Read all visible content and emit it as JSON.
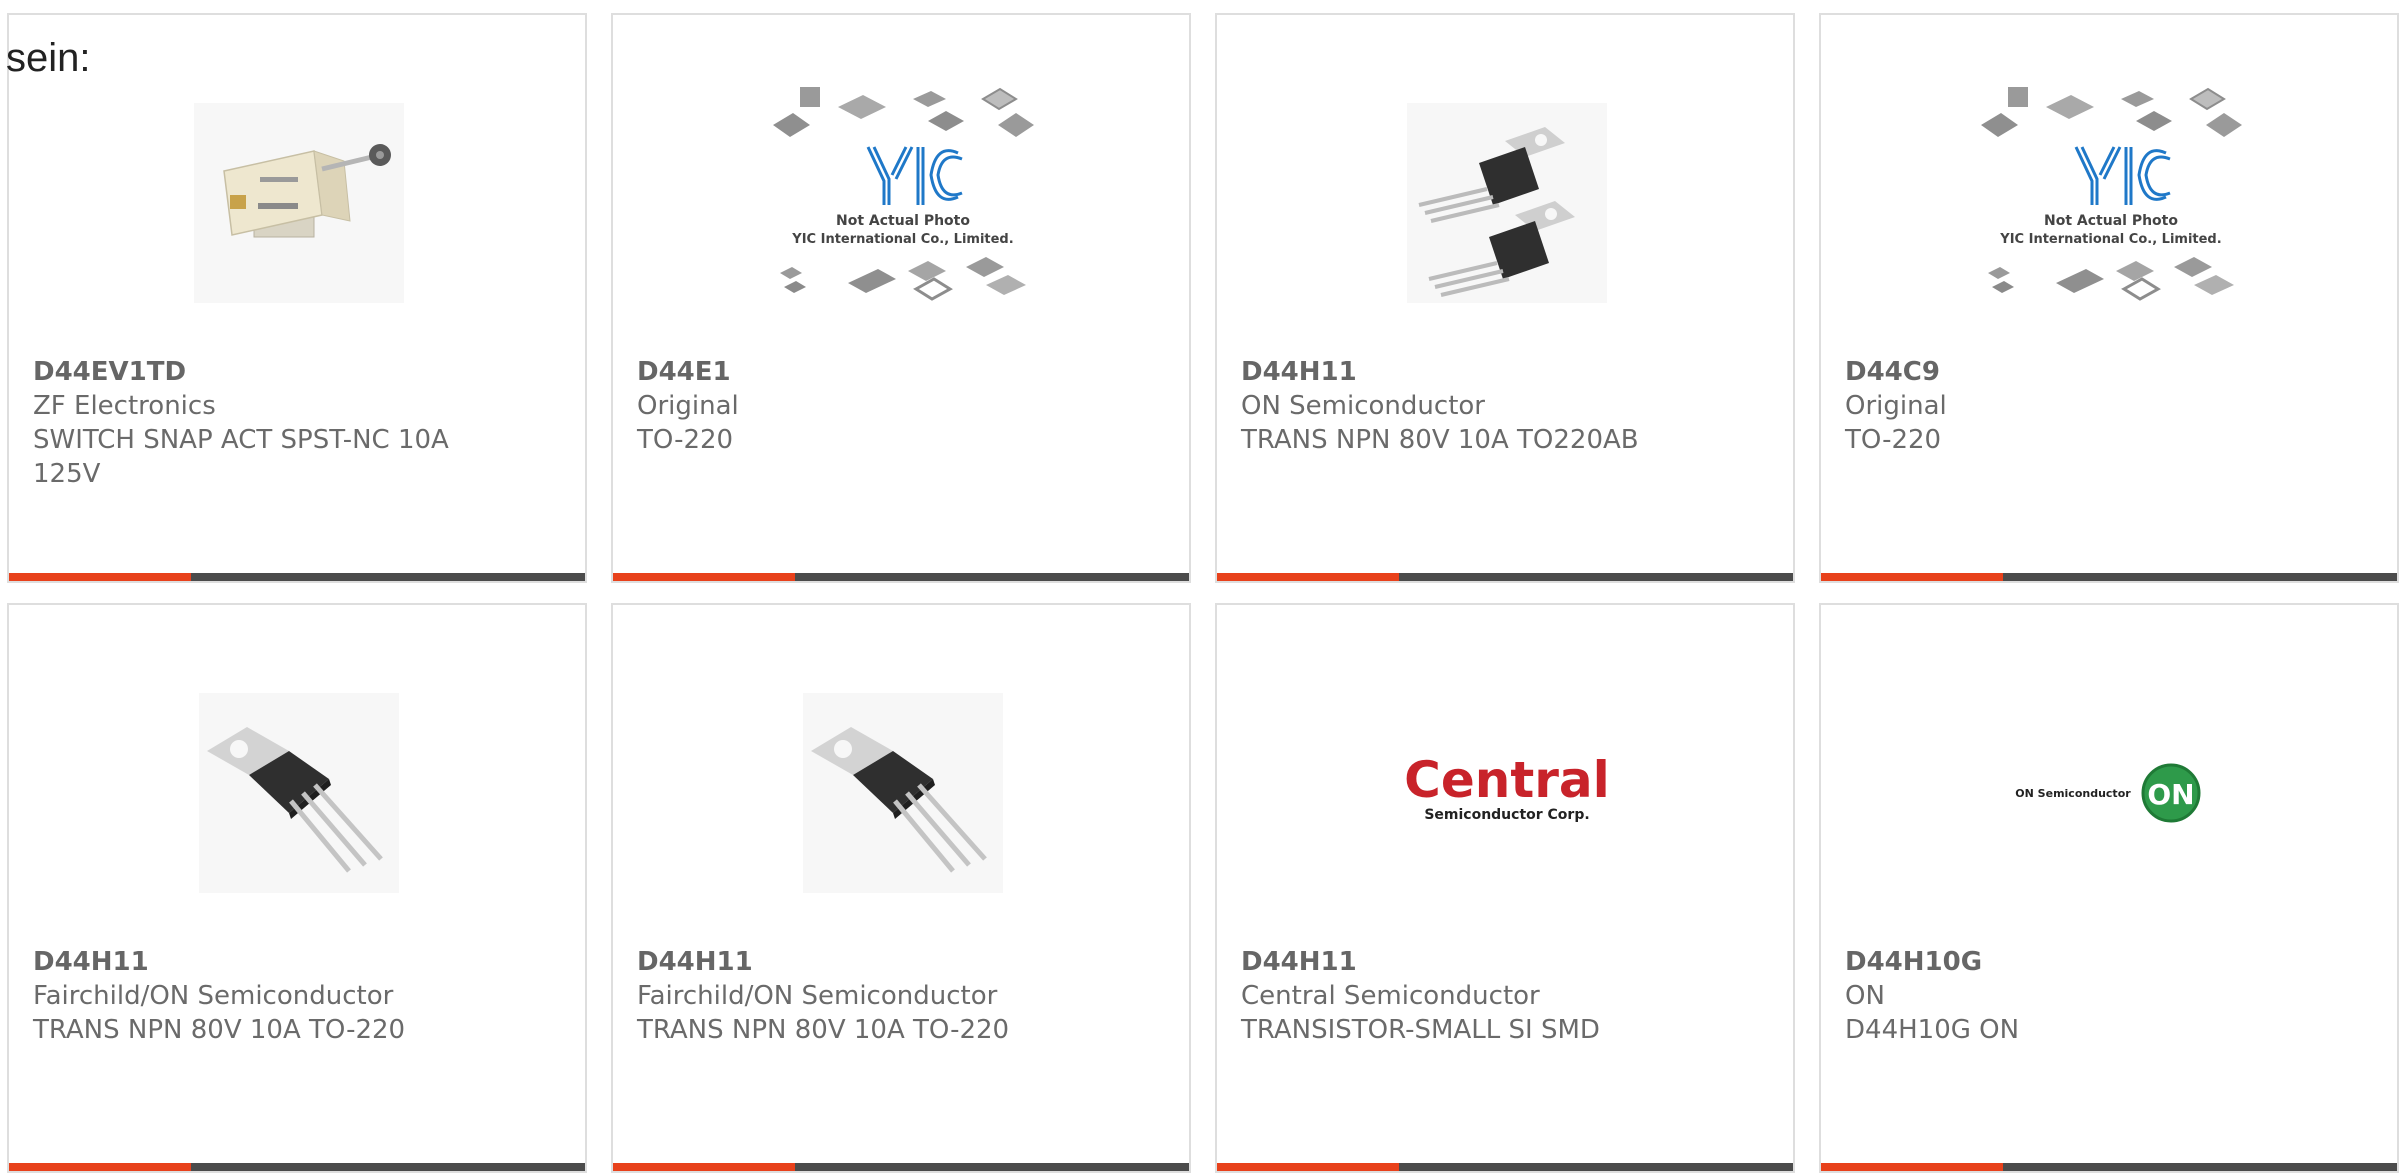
{
  "heading": "sein:",
  "products": [
    {
      "part_number": "D44EV1TD",
      "manufacturer": "ZF Electronics",
      "description": "SWITCH SNAP ACT SPST-NC 10A 125V",
      "image": "microswitch-photo"
    },
    {
      "part_number": "D44E1",
      "manufacturer": "Original",
      "description": "TO-220",
      "image": "yic-placeholder",
      "image_caption_line1": "Not Actual Photo",
      "image_caption_line2": "YIC International Co., Limited."
    },
    {
      "part_number": "D44H11",
      "manufacturer": "ON Semiconductor",
      "description": "TRANS NPN 80V 10A TO220AB",
      "image": "to220-pair-photo"
    },
    {
      "part_number": "D44C9",
      "manufacturer": "Original",
      "description": "TO-220",
      "image": "yic-placeholder",
      "image_caption_line1": "Not Actual Photo",
      "image_caption_line2": "YIC International Co., Limited."
    },
    {
      "part_number": "D44H11",
      "manufacturer": "Fairchild/ON Semiconductor",
      "description": "TRANS NPN 80V 10A TO-220",
      "image": "to220-photo"
    },
    {
      "part_number": "D44H11",
      "manufacturer": "Fairchild/ON Semiconductor",
      "description": "TRANS NPN 80V 10A TO-220",
      "image": "to220-photo"
    },
    {
      "part_number": "D44H11",
      "manufacturer": "Central Semiconductor",
      "description": "TRANSISTOR-SMALL SI SMD",
      "image": "central-semiconductor-logo",
      "logo_text": "Central",
      "logo_subtext": "Semiconductor Corp."
    },
    {
      "part_number": "D44H10G",
      "manufacturer": "ON",
      "description": "D44H10G ON",
      "image": "on-semiconductor-logo",
      "logo_text": "ON Semiconductor",
      "logo_badge": "ON"
    }
  ],
  "colors": {
    "accent": "#e8411b",
    "bar": "#4b4b4b",
    "card_border": "#dedede",
    "text": "#6a6a6a"
  }
}
